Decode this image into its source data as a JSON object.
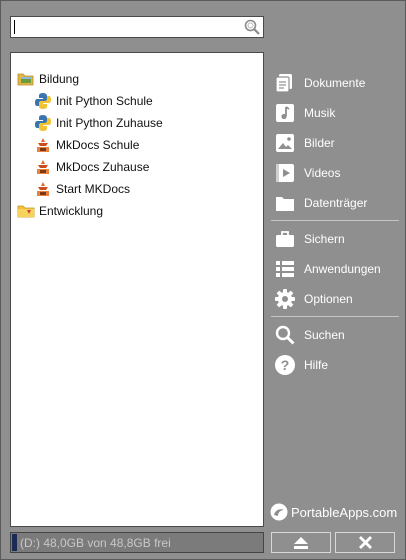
{
  "search": {
    "value": "",
    "placeholder": ""
  },
  "tree": {
    "groups": [
      {
        "label": "Bildung",
        "items": [
          {
            "label": "Init Python Schule",
            "icon": "python-icon"
          },
          {
            "label": "Init Python Zuhause",
            "icon": "python-icon"
          },
          {
            "label": "MkDocs Schule",
            "icon": "mkdocs-icon"
          },
          {
            "label": "MkDocs Zuhause",
            "icon": "mkdocs-icon"
          },
          {
            "label": "Start MKDocs",
            "icon": "mkdocs-icon"
          }
        ]
      },
      {
        "label": "Entwicklung",
        "items": []
      }
    ]
  },
  "menu": {
    "items": [
      {
        "label": "Dokumente",
        "icon": "documents-icon"
      },
      {
        "label": "Musik",
        "icon": "music-icon"
      },
      {
        "label": "Bilder",
        "icon": "pictures-icon"
      },
      {
        "label": "Videos",
        "icon": "videos-icon"
      },
      {
        "label": "Datenträger",
        "icon": "folder-icon"
      },
      {
        "label": "Sichern",
        "icon": "briefcase-icon"
      },
      {
        "label": "Anwendungen",
        "icon": "list-icon"
      },
      {
        "label": "Optionen",
        "icon": "gear-icon"
      },
      {
        "label": "Suchen",
        "icon": "search-icon"
      },
      {
        "label": "Hilfe",
        "icon": "help-icon"
      }
    ]
  },
  "brand": {
    "name": "PortableApps.com"
  },
  "status": {
    "text": "(D:) 48,0GB von 48,8GB frei",
    "used_fraction": 0.02
  },
  "colors": {
    "panel": "#8f8f8f",
    "status_bar": "#7b7b7b",
    "disk_fill": "#1b2a55"
  }
}
